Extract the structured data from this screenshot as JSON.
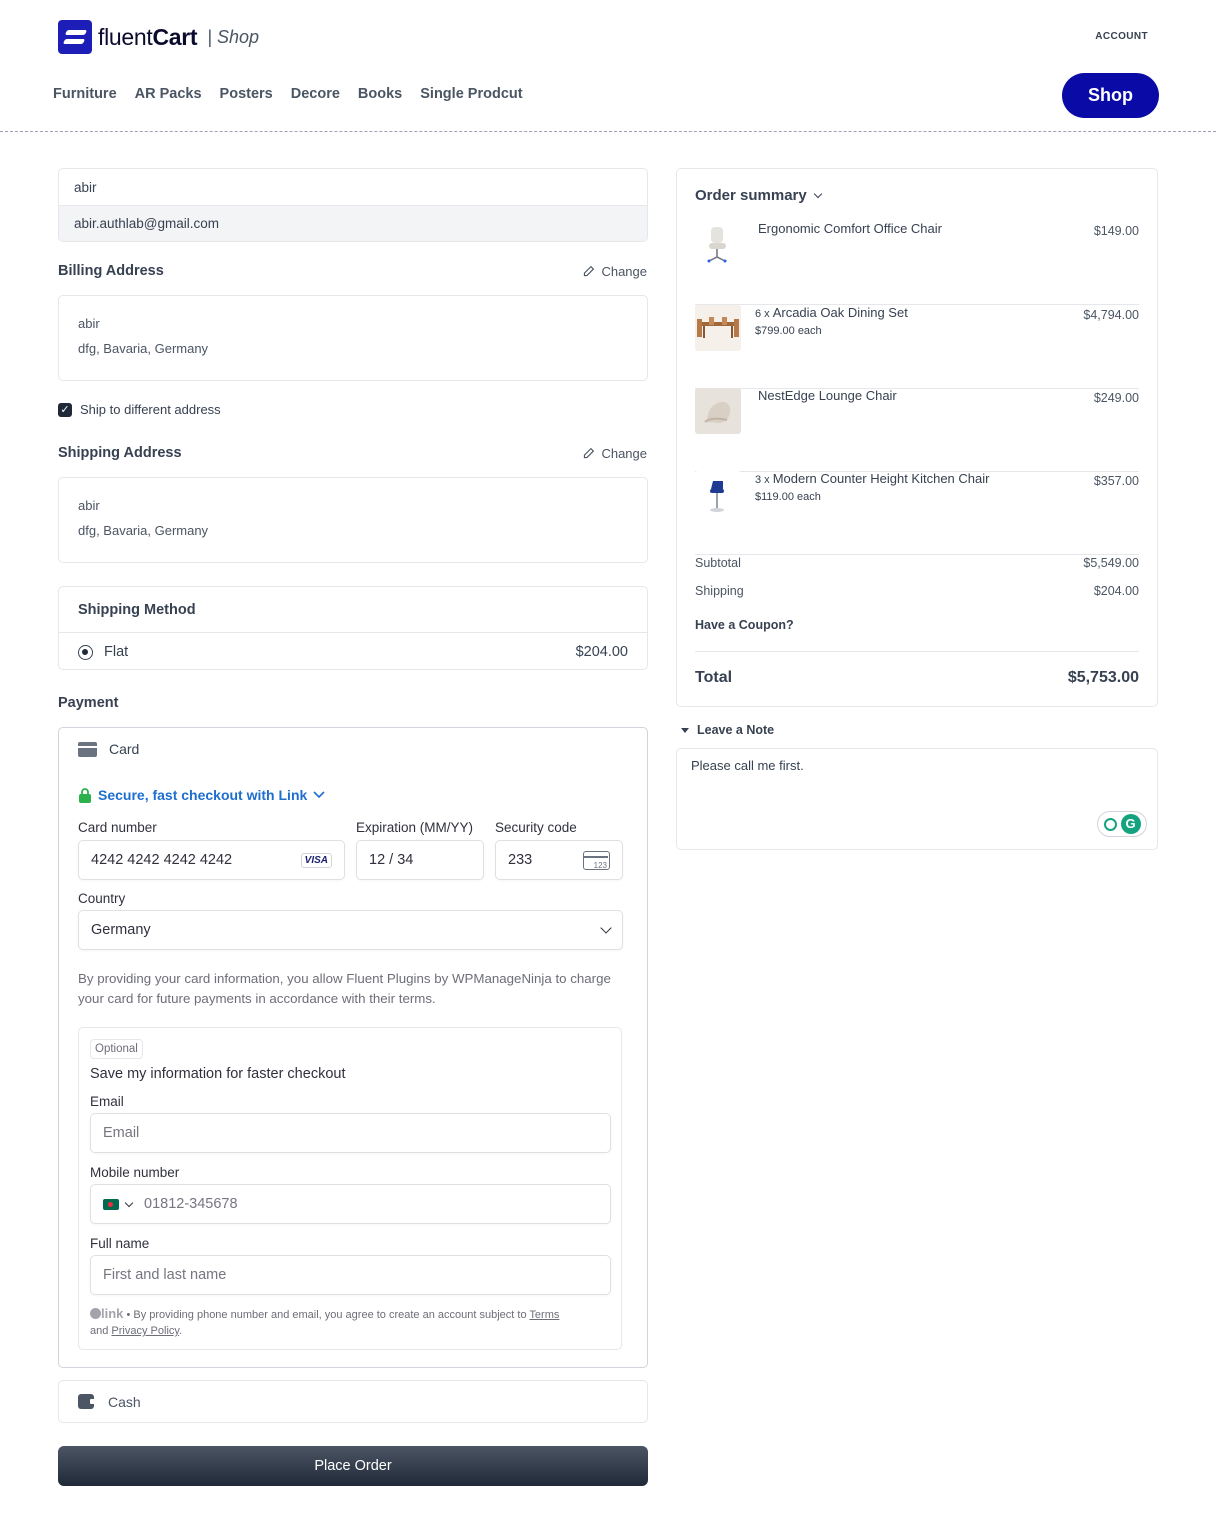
{
  "header": {
    "brand_light": "fluent",
    "brand_bold": "Cart",
    "brand_suffix": "| Shop",
    "account": "ACCOUNT",
    "nav": [
      "Furniture",
      "AR Packs",
      "Posters",
      "Decore",
      "Books",
      "Single Prodcut"
    ],
    "shop_button": "Shop",
    "brand_color": "#0a0aa6"
  },
  "contact": {
    "name": "abir",
    "email": "abir.authlab@gmail.com"
  },
  "billing": {
    "title": "Billing Address",
    "change": "Change",
    "name": "abir",
    "address": "dfg, Bavaria, Germany"
  },
  "ship_different": {
    "label": "Ship to different address",
    "checked": true
  },
  "shipping": {
    "title": "Shipping Address",
    "change": "Change",
    "name": "abir",
    "address": "dfg, Bavaria, Germany"
  },
  "shipping_method": {
    "title": "Shipping Method",
    "option_label": "Flat",
    "option_price": "$204.00"
  },
  "payment": {
    "title": "Payment",
    "card_label": "Card",
    "link_text": "Secure, fast checkout with Link",
    "card_number_label": "Card number",
    "card_number": "4242 4242 4242 4242",
    "card_brand": "VISA",
    "expiry_label": "Expiration (MM/YY)",
    "expiry": "12 / 34",
    "cvc_label": "Security code",
    "cvc": "233",
    "cvc_icon_text": "123",
    "country_label": "Country",
    "country": "Germany",
    "terms": "By providing your card information, you allow Fluent Plugins by WPManageNinja to charge your card for future payments in accordance with their terms.",
    "save": {
      "optional": "Optional",
      "title": "Save my information for faster checkout",
      "email_label": "Email",
      "email_placeholder": "Email",
      "mobile_label": "Mobile number",
      "mobile_placeholder": "01812-345678",
      "fullname_label": "Full name",
      "fullname_placeholder": "First and last name",
      "legal_brand": "link",
      "legal_text": " • By providing phone number and email, you agree to create an account subject to ",
      "terms_link": "Terms",
      "and_text": "and ",
      "privacy_link": "Privacy Policy",
      "end": "."
    },
    "cash_label": "Cash",
    "place_order": "Place Order"
  },
  "summary": {
    "title": "Order summary",
    "items": [
      {
        "qty": "",
        "name": "Ergonomic Comfort Office Chair",
        "each": "",
        "amount": "$149.00"
      },
      {
        "qty": "6 x",
        "name": "Arcadia Oak Dining Set",
        "each": "$799.00 each",
        "amount": "$4,794.00"
      },
      {
        "qty": "",
        "name": "NestEdge Lounge Chair",
        "each": "",
        "amount": "$249.00"
      },
      {
        "qty": "3 x",
        "name": "Modern Counter Height Kitchen Chair",
        "each": "$119.00 each",
        "amount": "$357.00"
      }
    ],
    "subtotal_label": "Subtotal",
    "subtotal": "$5,549.00",
    "shipping_label": "Shipping",
    "shipping": "$204.00",
    "coupon": "Have a Coupon?",
    "total_label": "Total",
    "total": "$5,753.00"
  },
  "note": {
    "title": "Leave a Note",
    "text": "Please call me first."
  }
}
